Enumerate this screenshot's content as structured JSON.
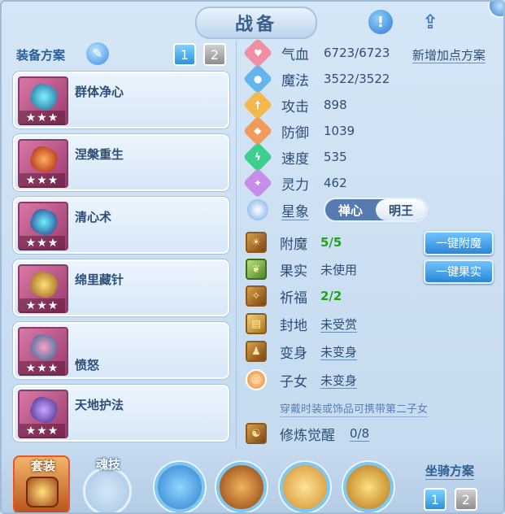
{
  "title": "战备",
  "left": {
    "section_title": "装备方案",
    "tabs": [
      "1",
      "2"
    ],
    "cards": [
      {
        "name": "群体净心",
        "stars": "★★★"
      },
      {
        "name": "涅槃重生",
        "stars": "★★★"
      },
      {
        "name": "清心术",
        "stars": "★★★"
      },
      {
        "name": "绵里藏针",
        "stars": "★★★"
      },
      {
        "name": "愤怒",
        "stars": "★★★"
      },
      {
        "name": "天地护法",
        "stars": "★★★"
      }
    ]
  },
  "stats": {
    "add_plan_label": "新增加点方案",
    "rows": [
      {
        "label": "气血",
        "value": "6723/6723",
        "icon": "heart-icon",
        "color": "#f08ea3"
      },
      {
        "label": "魔法",
        "value": "3522/3522",
        "icon": "mana-icon",
        "color": "#63b5f0"
      },
      {
        "label": "攻击",
        "value": "898",
        "icon": "sword-icon",
        "color": "#f5b84e"
      },
      {
        "label": "防御",
        "value": "1039",
        "icon": "shield-icon",
        "color": "#f29a5a"
      },
      {
        "label": "速度",
        "value": "535",
        "icon": "lightning-icon",
        "color": "#3ccf8e"
      },
      {
        "label": "灵力",
        "value": "462",
        "icon": "spirit-icon",
        "color": "#c68ee8"
      }
    ]
  },
  "astro": {
    "label": "星象",
    "options": [
      "禅心",
      "明王"
    ],
    "selected": "明王"
  },
  "features": [
    {
      "label": "附魔",
      "value": "5/5",
      "green": true,
      "button": "一键附魔"
    },
    {
      "label": "果实",
      "value": "未使用",
      "green": false,
      "button": "一键果实"
    },
    {
      "label": "祈福",
      "value": "2/2",
      "green": true
    },
    {
      "label": "封地",
      "value": "未受赏",
      "link": true
    },
    {
      "label": "变身",
      "value": "未变身",
      "link": true
    },
    {
      "label": "子女",
      "value": "未变身",
      "link": true
    }
  ],
  "hint": "穿戴时装或饰品可携带第二子女",
  "cultivation": {
    "label": "修炼觉醒",
    "value": "0/8"
  },
  "bottom": {
    "suit_label": "套装",
    "soul_label": "魂技",
    "mount_plan_label": "坐骑方案",
    "mount_tabs": [
      "1",
      "2"
    ]
  }
}
